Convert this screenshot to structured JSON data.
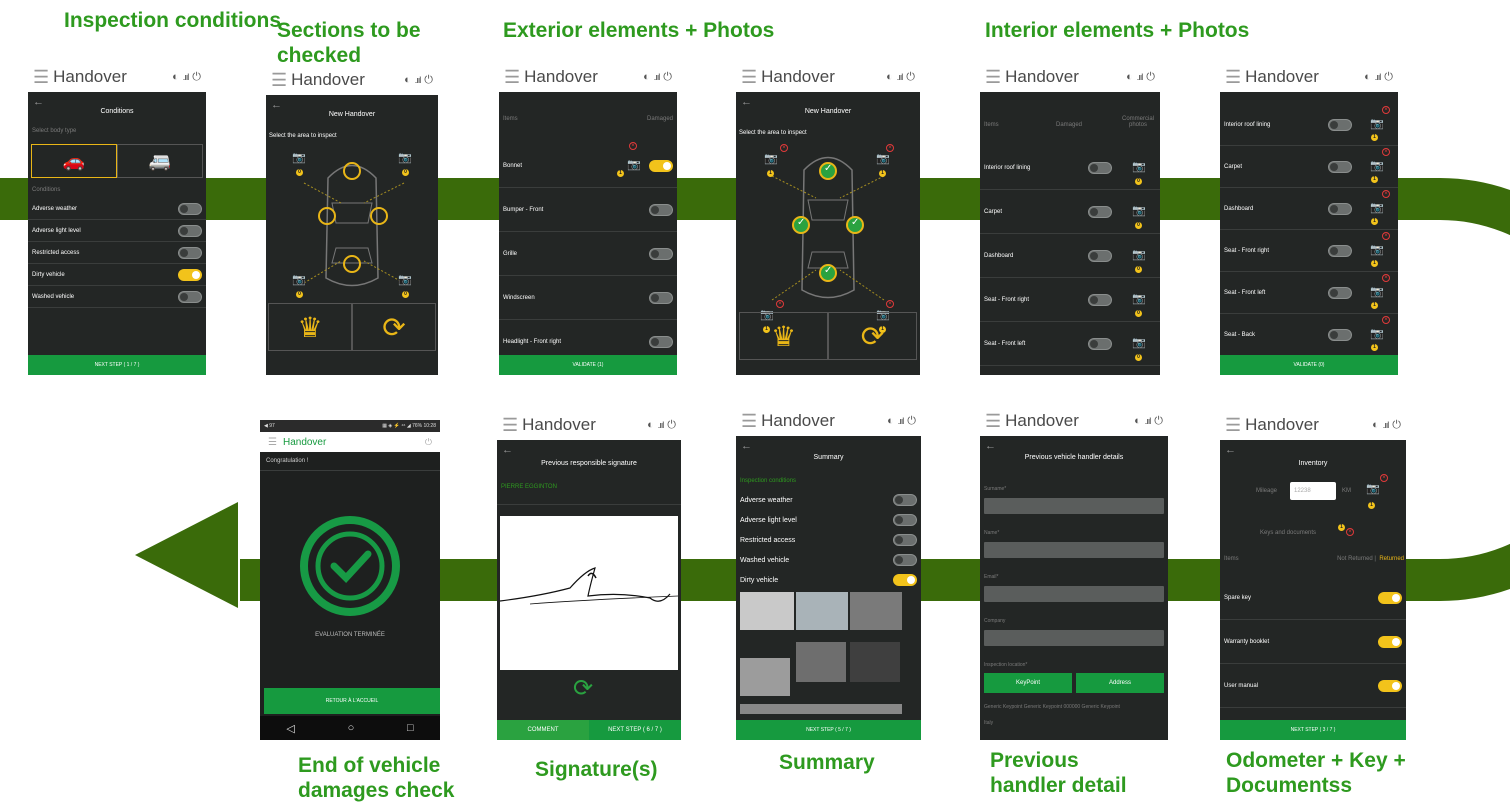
{
  "app": {
    "brand": "Handover"
  },
  "colors": {
    "accent": "#169a3f",
    "caption": "#2e9a1f",
    "toggle_on": "#f2c31b",
    "flow_arrow": "#3a6b0a",
    "screen_bg": "#232625"
  },
  "captions": {
    "inspection_conditions": "Inspection conditions",
    "sections_checked": "Sections to be checked",
    "exterior": "Exterior elements + Photos",
    "interior": "Interior elements + Photos",
    "end_check": "End of vehicle damages check",
    "signatures": "Signature(s)",
    "summary": "Summary",
    "previous_handler": "Previous handler detail",
    "odometer": "Odometer + Key + Documentss"
  },
  "s1": {
    "title": "Conditions",
    "body_type_label": "Select body type",
    "conditions_label": "Conditions",
    "rows": [
      {
        "label": "Adverse weather",
        "on": false
      },
      {
        "label": "Adverse light level",
        "on": false
      },
      {
        "label": "Restricted access",
        "on": false
      },
      {
        "label": "Dirty vehicle",
        "on": true
      },
      {
        "label": "Washed vehicle",
        "on": false
      }
    ],
    "footer": "NEXT STEP ( 1 / 7 )"
  },
  "s2": {
    "title": "New Handover",
    "instruction": "Select the area to inspect",
    "badge": "0"
  },
  "s3": {
    "col_items": "Items",
    "col_damaged": "Damaged",
    "rows": [
      {
        "label": "Bonnet",
        "on": true
      },
      {
        "label": "Bumper - Front",
        "on": false
      },
      {
        "label": "Grille",
        "on": false
      },
      {
        "label": "Windscreen",
        "on": false
      },
      {
        "label": "Headlight - Front right",
        "on": false
      }
    ],
    "badge": "1",
    "footer": "VALIDATE (1)"
  },
  "s4": {
    "title": "New Handover",
    "instruction": "Select the area to inspect",
    "badge": "1"
  },
  "s5": {
    "col_items": "Items",
    "col_damaged": "Damaged",
    "col_photos": "Commercial photos",
    "rows": [
      "Interior roof lining",
      "Carpet",
      "Dashboard",
      "Seat - Front right",
      "Seat - Front left"
    ],
    "badge": "0"
  },
  "s6": {
    "rows": [
      "Interior roof lining",
      "Carpet",
      "Dashboard",
      "Seat - Front right",
      "Seat - Front left",
      "Seat - Back"
    ],
    "badge": "1",
    "footer": "VALIDATE (0)"
  },
  "s7": {
    "status_left": "◀ 97",
    "status_right": "▦ ◈ ⚡ ⁴⁶ ◢ 76% 10:28",
    "congrats": "Congratulation !",
    "done": "EVALUATION TERMINÉE",
    "button": "RETOUR À L'ACCUEIL"
  },
  "s8": {
    "title": "Previous responsible signature",
    "name": "PIERRE EGGINTON",
    "comment": "COMMENT",
    "next": "NEXT STEP ( 6 / 7 )"
  },
  "s9": {
    "title": "Summary",
    "section": "Inspection conditions",
    "rows": [
      {
        "label": "Adverse weather",
        "on": false
      },
      {
        "label": "Adverse light level",
        "on": false
      },
      {
        "label": "Restricted access",
        "on": false
      },
      {
        "label": "Washed vehicle",
        "on": false
      },
      {
        "label": "Dirty vehicle",
        "on": true
      }
    ],
    "footer": "NEXT STEP ( 5 / 7 )"
  },
  "s10": {
    "title": "Previous vehicle handler details",
    "surname": "Surname*",
    "name": "Name*",
    "email": "Email*",
    "company": "Company",
    "location": "Inspection location*",
    "keypoint": "KeyPoint",
    "address": "Address",
    "generic": "Generic Keypoint Generic Keypoint 000000 Generic Keypoint",
    "italy": "Italy"
  },
  "s11": {
    "title": "Inventory",
    "mileage_label": "Mileage",
    "mileage_placeholder": "12238",
    "km": "KM",
    "keys_docs": "Keys and documents",
    "col_items": "Items",
    "col_status_a": "Not Returned |",
    "col_status_b": "Returned",
    "rows": [
      "Spare key",
      "Warranty booklet",
      "User manual"
    ],
    "badge": "1",
    "footer": "NEXT STEP ( 3 / 7 )"
  }
}
